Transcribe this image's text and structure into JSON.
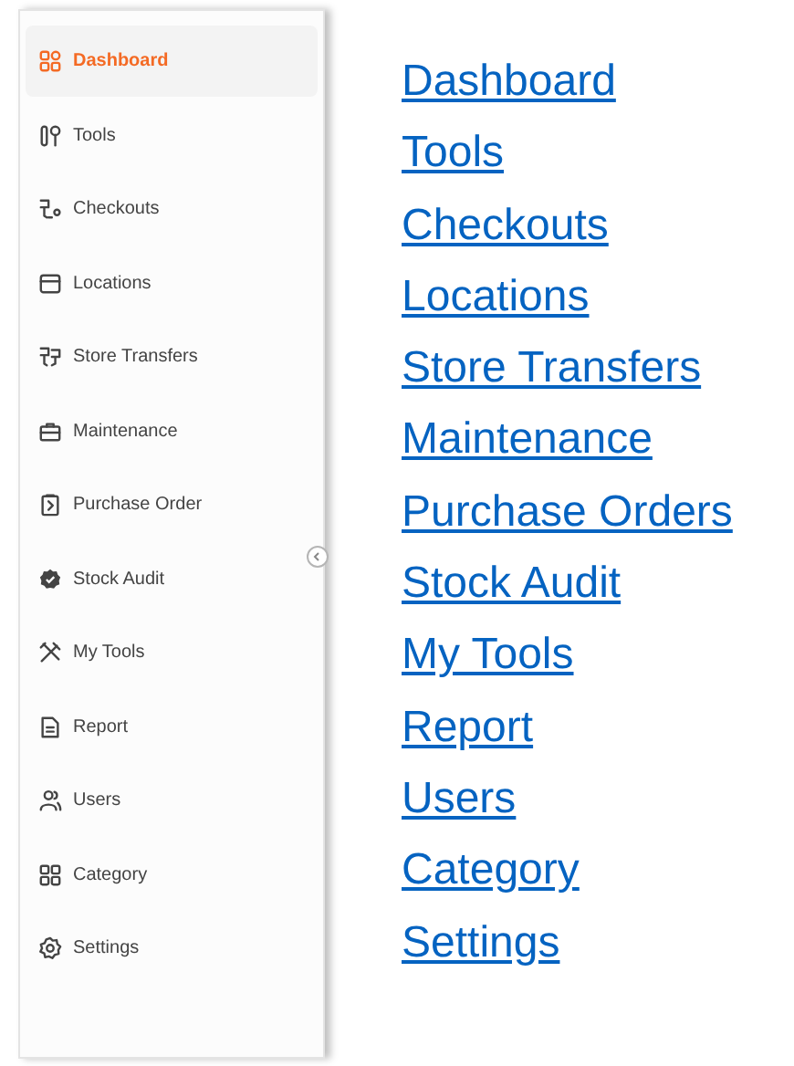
{
  "sidebar": {
    "items": [
      {
        "label": "Dashboard",
        "selected": true
      },
      {
        "label": "Tools",
        "selected": false
      },
      {
        "label": "Checkouts",
        "selected": false
      },
      {
        "label": "Locations",
        "selected": false
      },
      {
        "label": "Store Transfers",
        "selected": false
      },
      {
        "label": "Maintenance",
        "selected": false
      },
      {
        "label": "Purchase Order",
        "selected": false
      },
      {
        "label": "Stock Audit",
        "selected": false
      },
      {
        "label": "My Tools",
        "selected": false
      },
      {
        "label": "Report",
        "selected": false
      },
      {
        "label": "Users",
        "selected": false
      },
      {
        "label": "Category",
        "selected": false
      },
      {
        "label": "Settings",
        "selected": false
      }
    ]
  },
  "links": [
    "Dashboard",
    "Tools",
    "Checkouts",
    "Locations",
    "Store Transfers",
    "Maintenance",
    "Purchase Orders",
    "Stock Audit",
    "My Tools",
    "Report",
    "Users",
    "Category",
    "Settings"
  ]
}
